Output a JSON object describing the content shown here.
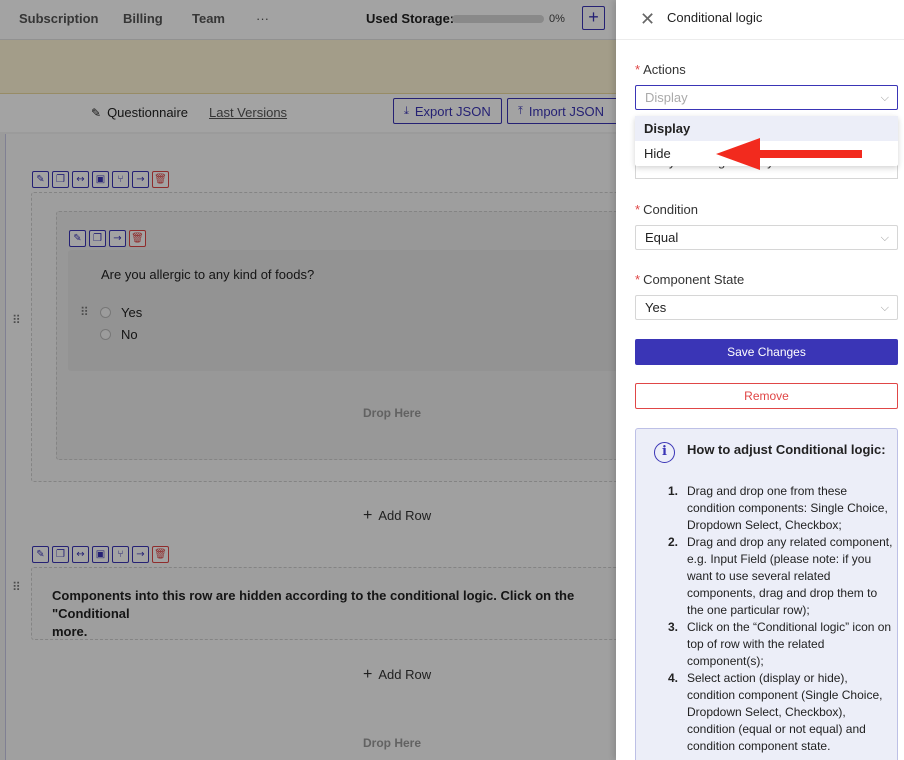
{
  "topnav": {
    "items": [
      "Subscription",
      "Billing",
      "Team",
      "···"
    ],
    "storage_label": "Used Storage:",
    "storage_pct": "0%",
    "storage_fraction": 0.0,
    "add_label": "+"
  },
  "subbar": {
    "questionnaire": "Questionnaire",
    "last_versions": "Last Versions",
    "export_json": "Export JSON",
    "import_json": "Import JSON"
  },
  "canvas": {
    "question": "Are you allergic to any kind of foods?",
    "options": [
      "Yes",
      "No"
    ],
    "drop_here": "Drop Here",
    "add_row": "Add Row",
    "hidden_notice": "Components into this row are hidden according to the conditional logic. Click on the \"Conditional",
    "hidden_notice_more": "more."
  },
  "panel": {
    "title": "Conditional logic",
    "actions_label": "Actions",
    "actions_placeholder": "Display",
    "dropdown_options": [
      "Display",
      "Hide"
    ],
    "behind_text": "Are you allergic to any kind of foods?",
    "condition_label": "Condition",
    "condition_value": "Equal",
    "state_label": "Component State",
    "state_value": "Yes",
    "save_label": "Save Changes",
    "remove_label": "Remove",
    "info": {
      "title": "How to adjust Conditional logic:",
      "steps": [
        {
          "num": "1.",
          "text": "Drag and drop one from these condition components: Single Choice, Dropdown Select, Checkbox;"
        },
        {
          "num": "2.",
          "text": "Drag and drop any related component, e.g. Input Field (please note: if you want to use several related components, drag and drop them to the one particular row);"
        },
        {
          "num": "3.",
          "text": "Click on the “Conditional logic” icon on top of row with the related component(s);"
        },
        {
          "num": "4.",
          "text": "Select action (display or hide), condition component (Single Choice, Dropdown Select, Checkbox), condition (equal or not equal) and condition component state."
        }
      ]
    }
  },
  "colors": {
    "accent": "#3a35b6",
    "danger": "#e04646",
    "arrow": "#f22a1e"
  }
}
